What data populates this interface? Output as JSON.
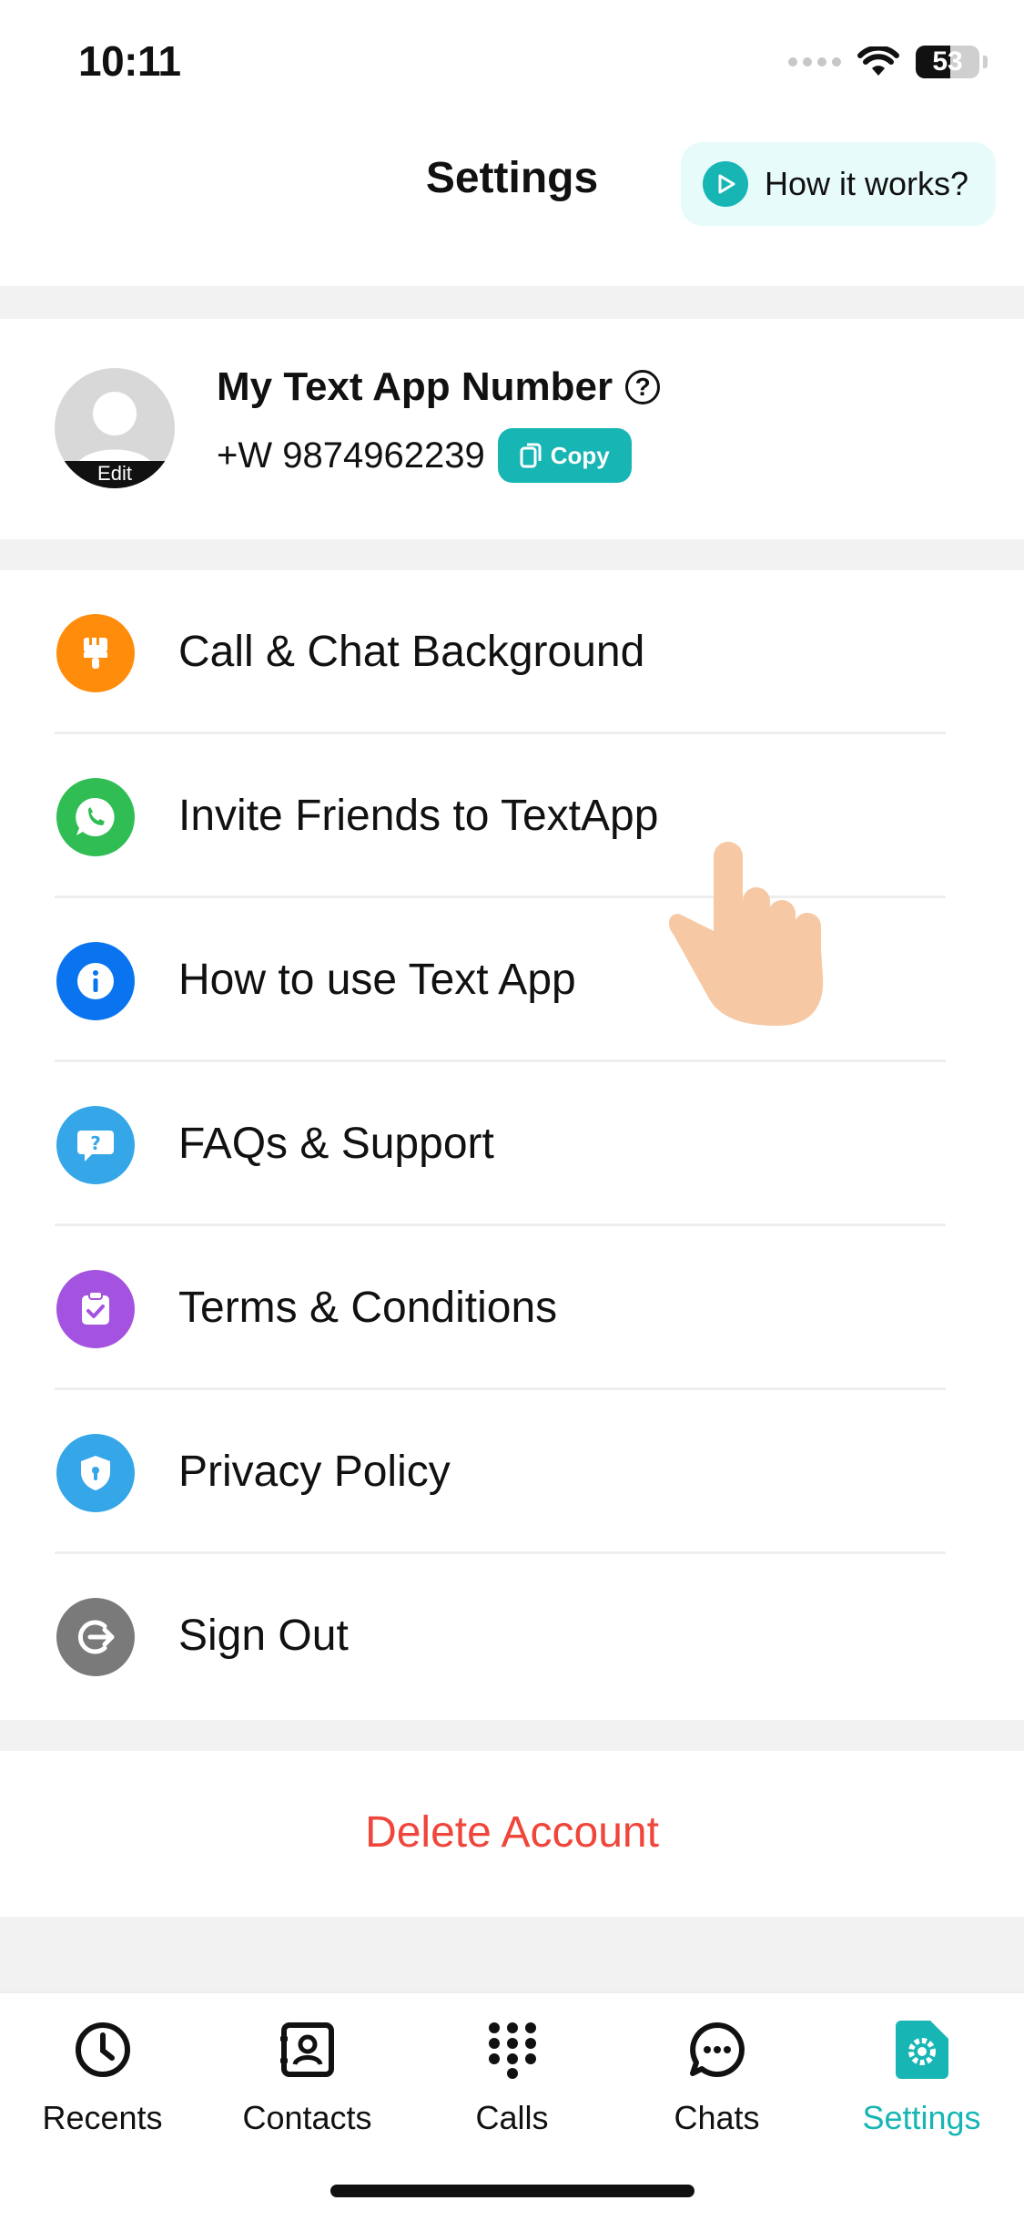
{
  "status_bar": {
    "time": "10:11",
    "battery": "53"
  },
  "header": {
    "title": "Settings",
    "how_button_label": "How it works?"
  },
  "profile": {
    "edit_label": "Edit",
    "title": "My Text App Number",
    "phone": "+W 9874962239",
    "copy_label": "Copy"
  },
  "menu": {
    "items": [
      {
        "label": "Call & Chat Background",
        "icon": "paintbrush-icon",
        "color": "#ff8c0a"
      },
      {
        "label": "Invite Friends to TextApp",
        "icon": "whatsapp-icon",
        "color": "#2fbd54"
      },
      {
        "label": "How to use Text App",
        "icon": "info-icon",
        "color": "#0a74f0"
      },
      {
        "label": "FAQs & Support",
        "icon": "question-chat-icon",
        "color": "#35a6e8"
      },
      {
        "label": "Terms & Conditions",
        "icon": "clipboard-check-icon",
        "color": "#a452e0"
      },
      {
        "label": "Privacy Policy",
        "icon": "shield-icon",
        "color": "#35a6e8"
      },
      {
        "label": "Sign Out",
        "icon": "sign-out-icon",
        "color": "#7a7a7a"
      }
    ]
  },
  "delete_account": {
    "label": "Delete Account",
    "color": "#f0453a"
  },
  "tabbar": {
    "tabs": [
      {
        "label": "Recents",
        "icon": "clock-icon"
      },
      {
        "label": "Contacts",
        "icon": "contact-card-icon"
      },
      {
        "label": "Calls",
        "icon": "dialpad-icon"
      },
      {
        "label": "Chats",
        "icon": "chat-bubble-icon"
      },
      {
        "label": "Settings",
        "icon": "settings-icon",
        "active": true
      }
    ]
  },
  "colors": {
    "accent": "#18b5b5",
    "band": "#f2f2f2"
  }
}
